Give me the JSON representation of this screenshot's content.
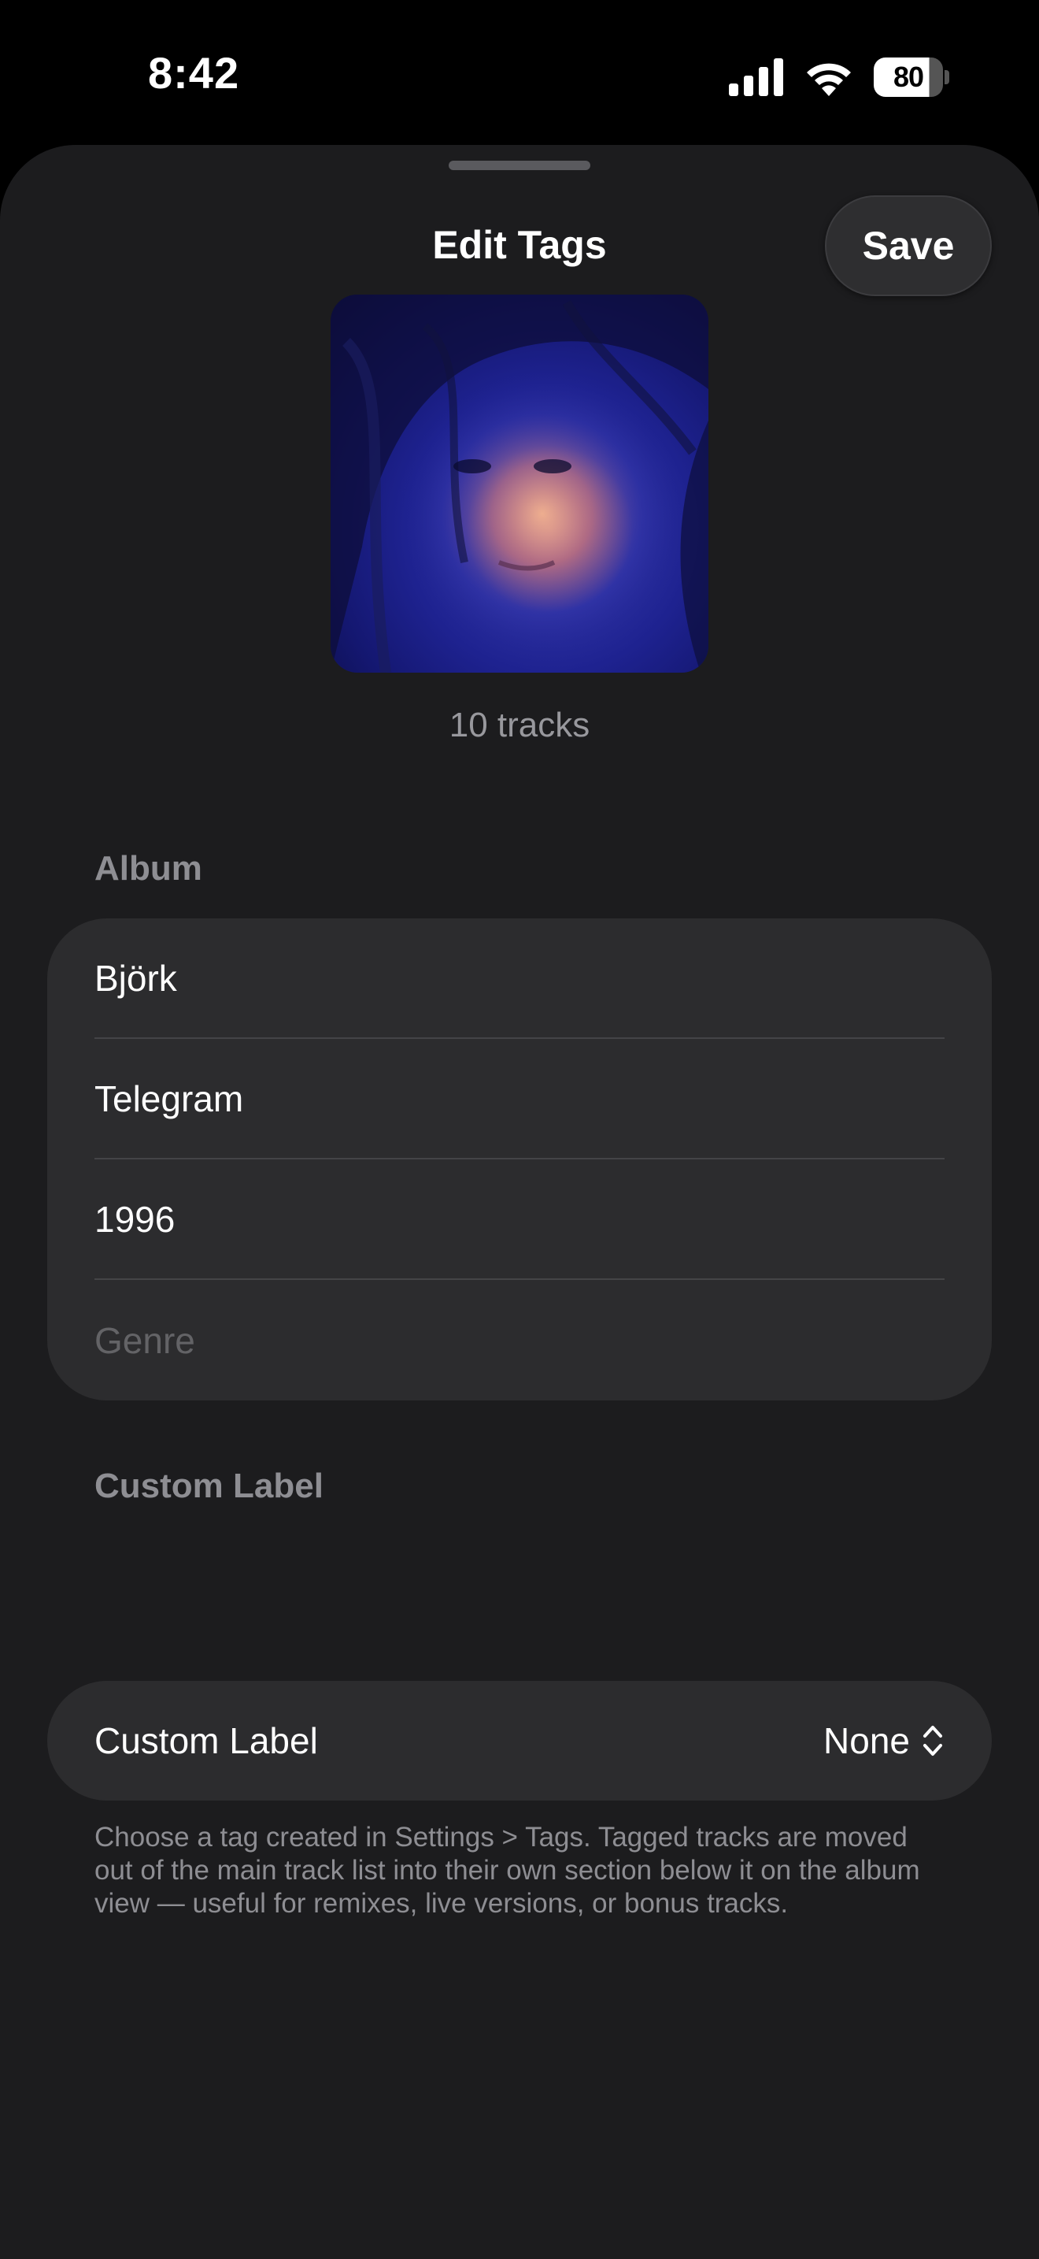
{
  "status": {
    "time": "8:42",
    "battery": "80"
  },
  "sheet": {
    "title": "Edit Tags",
    "save_label": "Save"
  },
  "artwork": {
    "track_count": "10 tracks"
  },
  "album_section": {
    "header": "Album",
    "fields": {
      "artist": "Björk",
      "album": "Telegram",
      "year": "1996",
      "genre_placeholder": "Genre"
    }
  },
  "custom_label_section": {
    "header": "Custom Label",
    "row_label": "Custom Label",
    "selected_value": "None",
    "footer": "Choose a tag created in Settings > Tags. Tagged tracks are moved out of the main track list into their own section below it on the album view — useful for remixes, live versions, or bonus tracks."
  },
  "icons": {
    "signal": "cellular-signal-icon",
    "wifi": "wifi-icon",
    "battery": "battery-icon",
    "picker": "chevron-up-down-icon"
  }
}
